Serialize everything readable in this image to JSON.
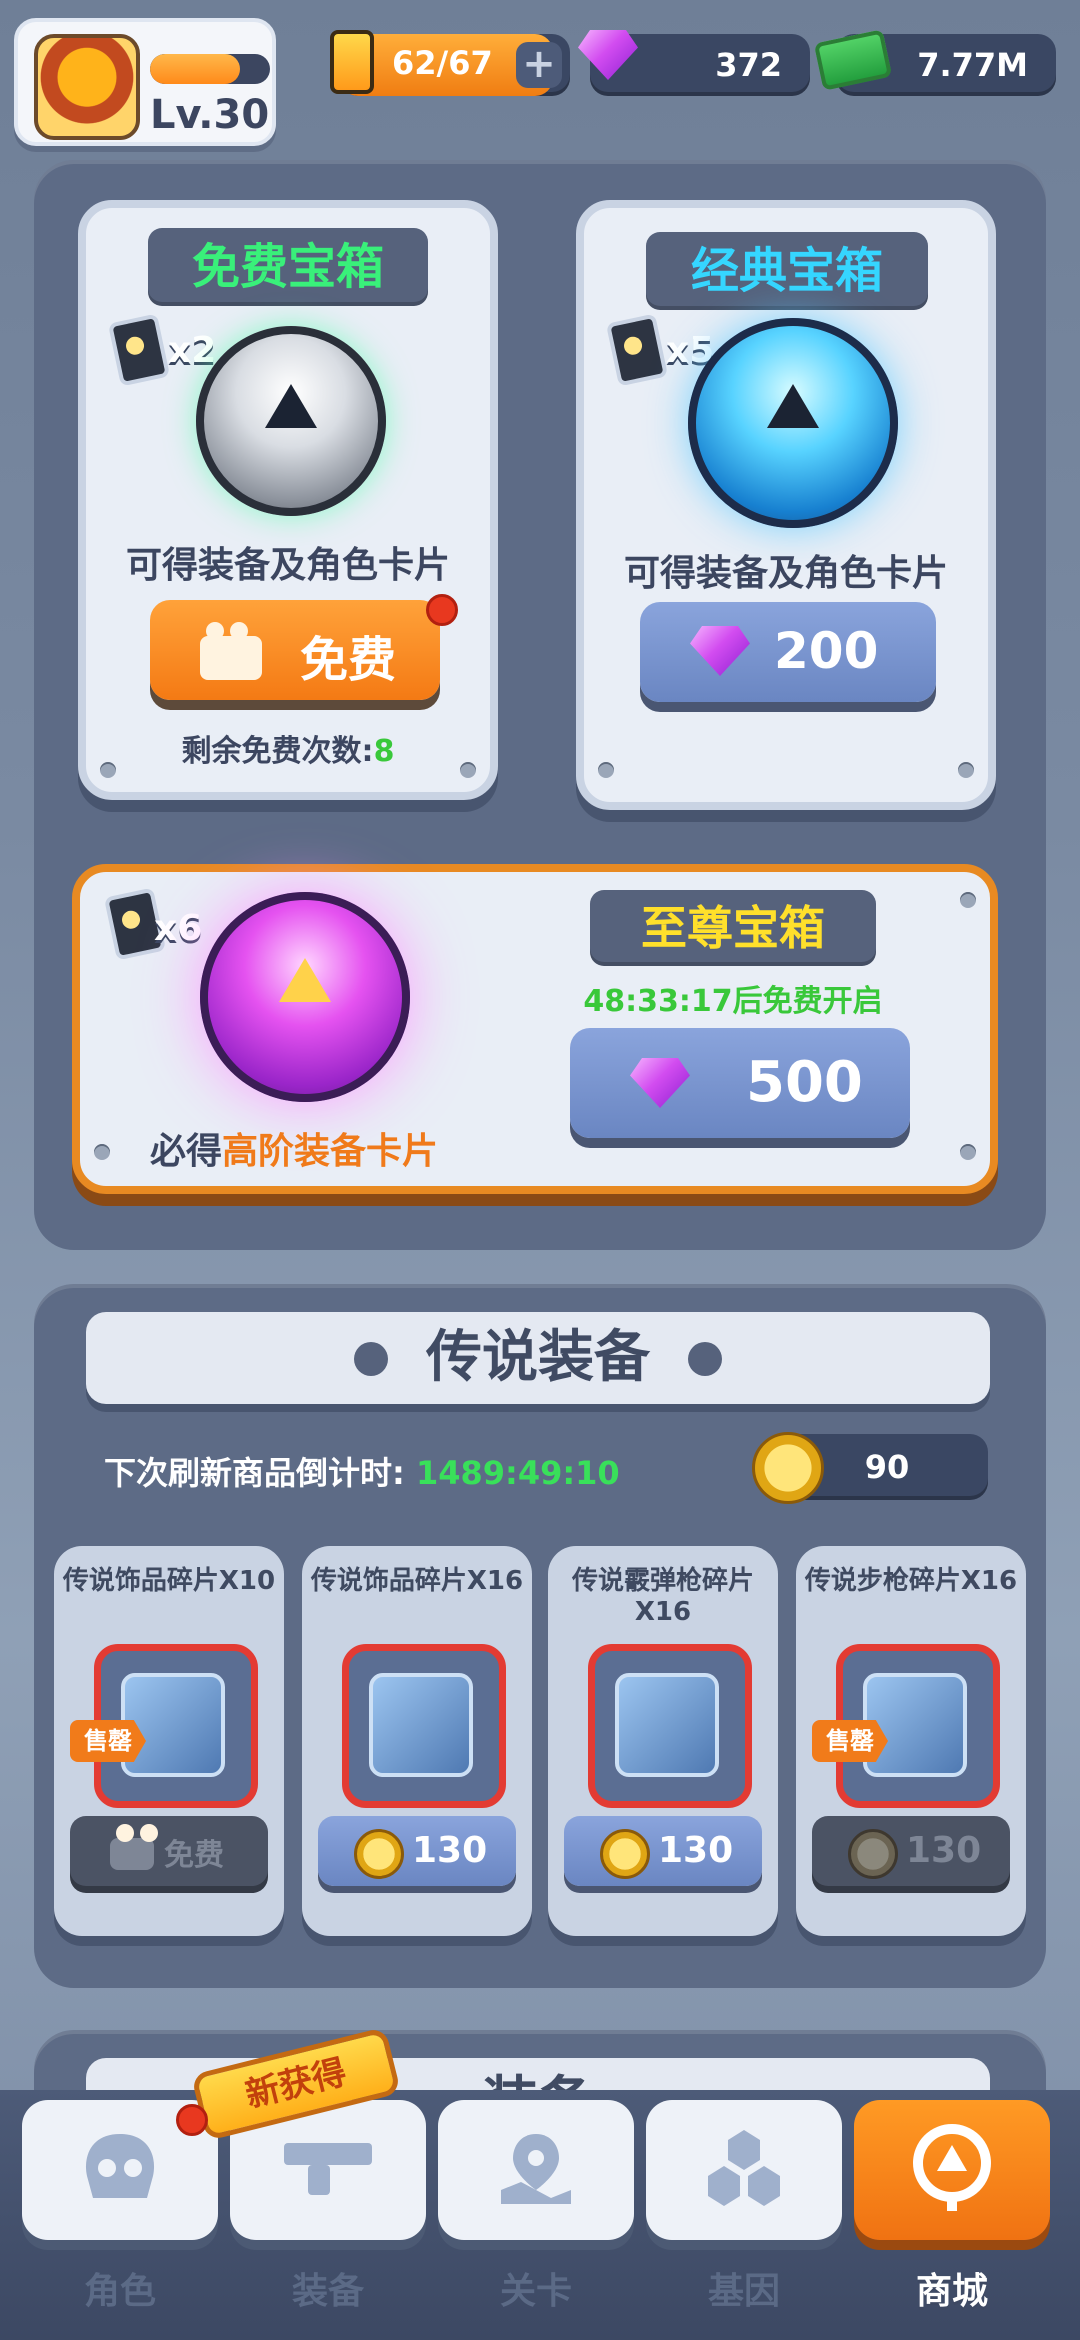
{
  "player": {
    "level": "Lv.30",
    "xp_fraction": 0.75
  },
  "resources": {
    "energy": "62/67",
    "energy_fraction": 0.925,
    "gems": "372",
    "cash": "7.77M"
  },
  "chests": {
    "free": {
      "title": "免费宝箱",
      "multiplier": "x2",
      "desc": "可得装备及角色卡片",
      "button": "免费",
      "remaining_label": "剩余免费次数:",
      "remaining_count": "8"
    },
    "classic": {
      "title": "经典宝箱",
      "multiplier": "x5",
      "desc": "可得装备及角色卡片",
      "price": "200"
    },
    "supreme": {
      "title": "至尊宝箱",
      "multiplier": "x6",
      "timer": "48:33:17后免费开启",
      "desc_prefix": "必得",
      "desc_highlight": "高阶装备卡片",
      "price": "500"
    }
  },
  "legendary": {
    "title": "传说装备",
    "refresh_label": "下次刷新商品倒计时:",
    "refresh_timer": "1489:49:10",
    "coins": "90",
    "items": [
      {
        "name": "传说饰品碎片X10",
        "price": "免费",
        "sale": "售罄",
        "disabled": true,
        "kind": "video"
      },
      {
        "name": "传说饰品碎片X16",
        "price": "130",
        "sale": "",
        "disabled": false,
        "kind": "coin"
      },
      {
        "name": "传说霰弹枪碎片X16",
        "price": "130",
        "sale": "",
        "disabled": false,
        "kind": "coin"
      },
      {
        "name": "传说步枪碎片X16",
        "price": "130",
        "sale": "售罄",
        "disabled": true,
        "kind": "coin"
      }
    ]
  },
  "next_section": {
    "title": "装备"
  },
  "nav": {
    "new_badge": "新获得",
    "tabs": [
      {
        "label": "角色",
        "icon": "skull-icon"
      },
      {
        "label": "装备",
        "icon": "gun-icon"
      },
      {
        "label": "关卡",
        "icon": "map-pin-icon"
      },
      {
        "label": "基因",
        "icon": "hexagons-icon"
      },
      {
        "label": "商城",
        "icon": "shop-icon",
        "active": true
      }
    ]
  },
  "colors": {
    "green_title": "#39f07a",
    "blue_title": "#35d6ff",
    "yellow_title": "#ffe02b",
    "timer_green": "#39c83a",
    "highlight_orange": "#f07a1a",
    "active_tab": "#f07212"
  }
}
